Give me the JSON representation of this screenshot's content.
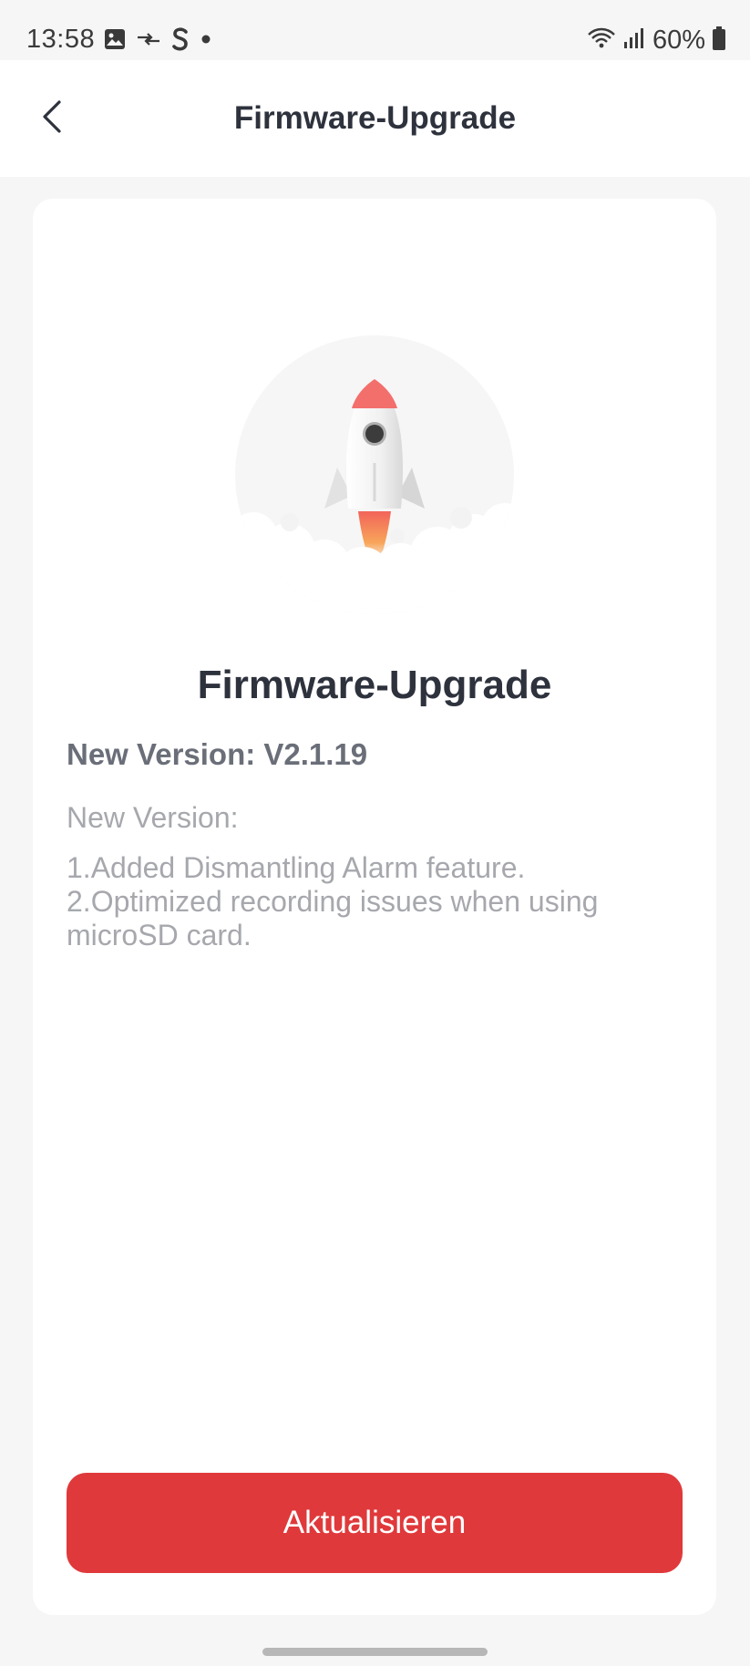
{
  "status_bar": {
    "time": "13:58",
    "battery": "60%",
    "icons_left": [
      "image-icon",
      "transfer-icon",
      "app-s-icon",
      "dot-icon"
    ],
    "icons_right": [
      "wifi-icon",
      "signal-icon",
      "battery-icon"
    ]
  },
  "app_bar": {
    "title": "Firmware-Upgrade",
    "back_icon": "chevron-left-icon"
  },
  "card": {
    "illustration": "rocket-icon",
    "title": "Firmware-Upgrade",
    "version_line": "New Version: V2.1.19",
    "notes_heading": "New Version:",
    "notes": [
      "1.Added Dismantling Alarm feature.",
      "2.Optimized recording issues when using microSD card."
    ],
    "button_label": "Aktualisieren"
  },
  "colors": {
    "accent": "#e0393b",
    "title_text": "#2e323d",
    "muted_text": "#a6a8ad",
    "background": "#f6f6f6"
  }
}
